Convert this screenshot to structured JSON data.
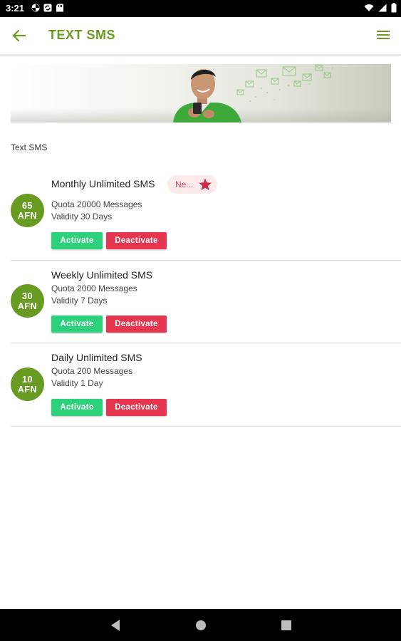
{
  "status_bar": {
    "time": "3:21",
    "icons": [
      "photos-icon",
      "sync-icon",
      "sd-card-icon"
    ],
    "right_icons": [
      "wifi-icon",
      "signal-icon",
      "battery-icon"
    ]
  },
  "app_bar": {
    "title": "TEXT SMS",
    "back_icon": "arrow-left-icon",
    "menu_icon": "hamburger-menu-icon"
  },
  "banner": {
    "image": "man-with-phone-sms-banner"
  },
  "section_label": "Text SMS",
  "packages": [
    {
      "name": "Monthly Unlimited SMS",
      "price_amount": "65",
      "price_currency": "AFN",
      "quota": "Quota 20000 Messages",
      "validity": "Validity 30 Days",
      "badge": "Ne...",
      "activate_label": "Activate",
      "deactivate_label": "Deactivate"
    },
    {
      "name": "Weekly Unlimited SMS",
      "price_amount": "30",
      "price_currency": "AFN",
      "quota": "Quota 2000 Messages",
      "validity": "Validity 7 Days",
      "activate_label": "Activate",
      "deactivate_label": "Deactivate"
    },
    {
      "name": "Daily Unlimited SMS",
      "price_amount": "10",
      "price_currency": "AFN",
      "quota": "Quota 200 Messages",
      "validity": "Validity 1 Day",
      "activate_label": "Activate",
      "deactivate_label": "Deactivate"
    }
  ],
  "colors": {
    "brand_green": "#6a9a21",
    "price_circle": "#679b22",
    "activate": "#2dd07b",
    "deactivate": "#e5354f",
    "badge_bg": "#fdeaea",
    "badge_text": "#d9435a"
  },
  "nav_bar": {
    "icons": [
      "back-triangle-icon",
      "home-circle-icon",
      "recents-square-icon"
    ]
  }
}
